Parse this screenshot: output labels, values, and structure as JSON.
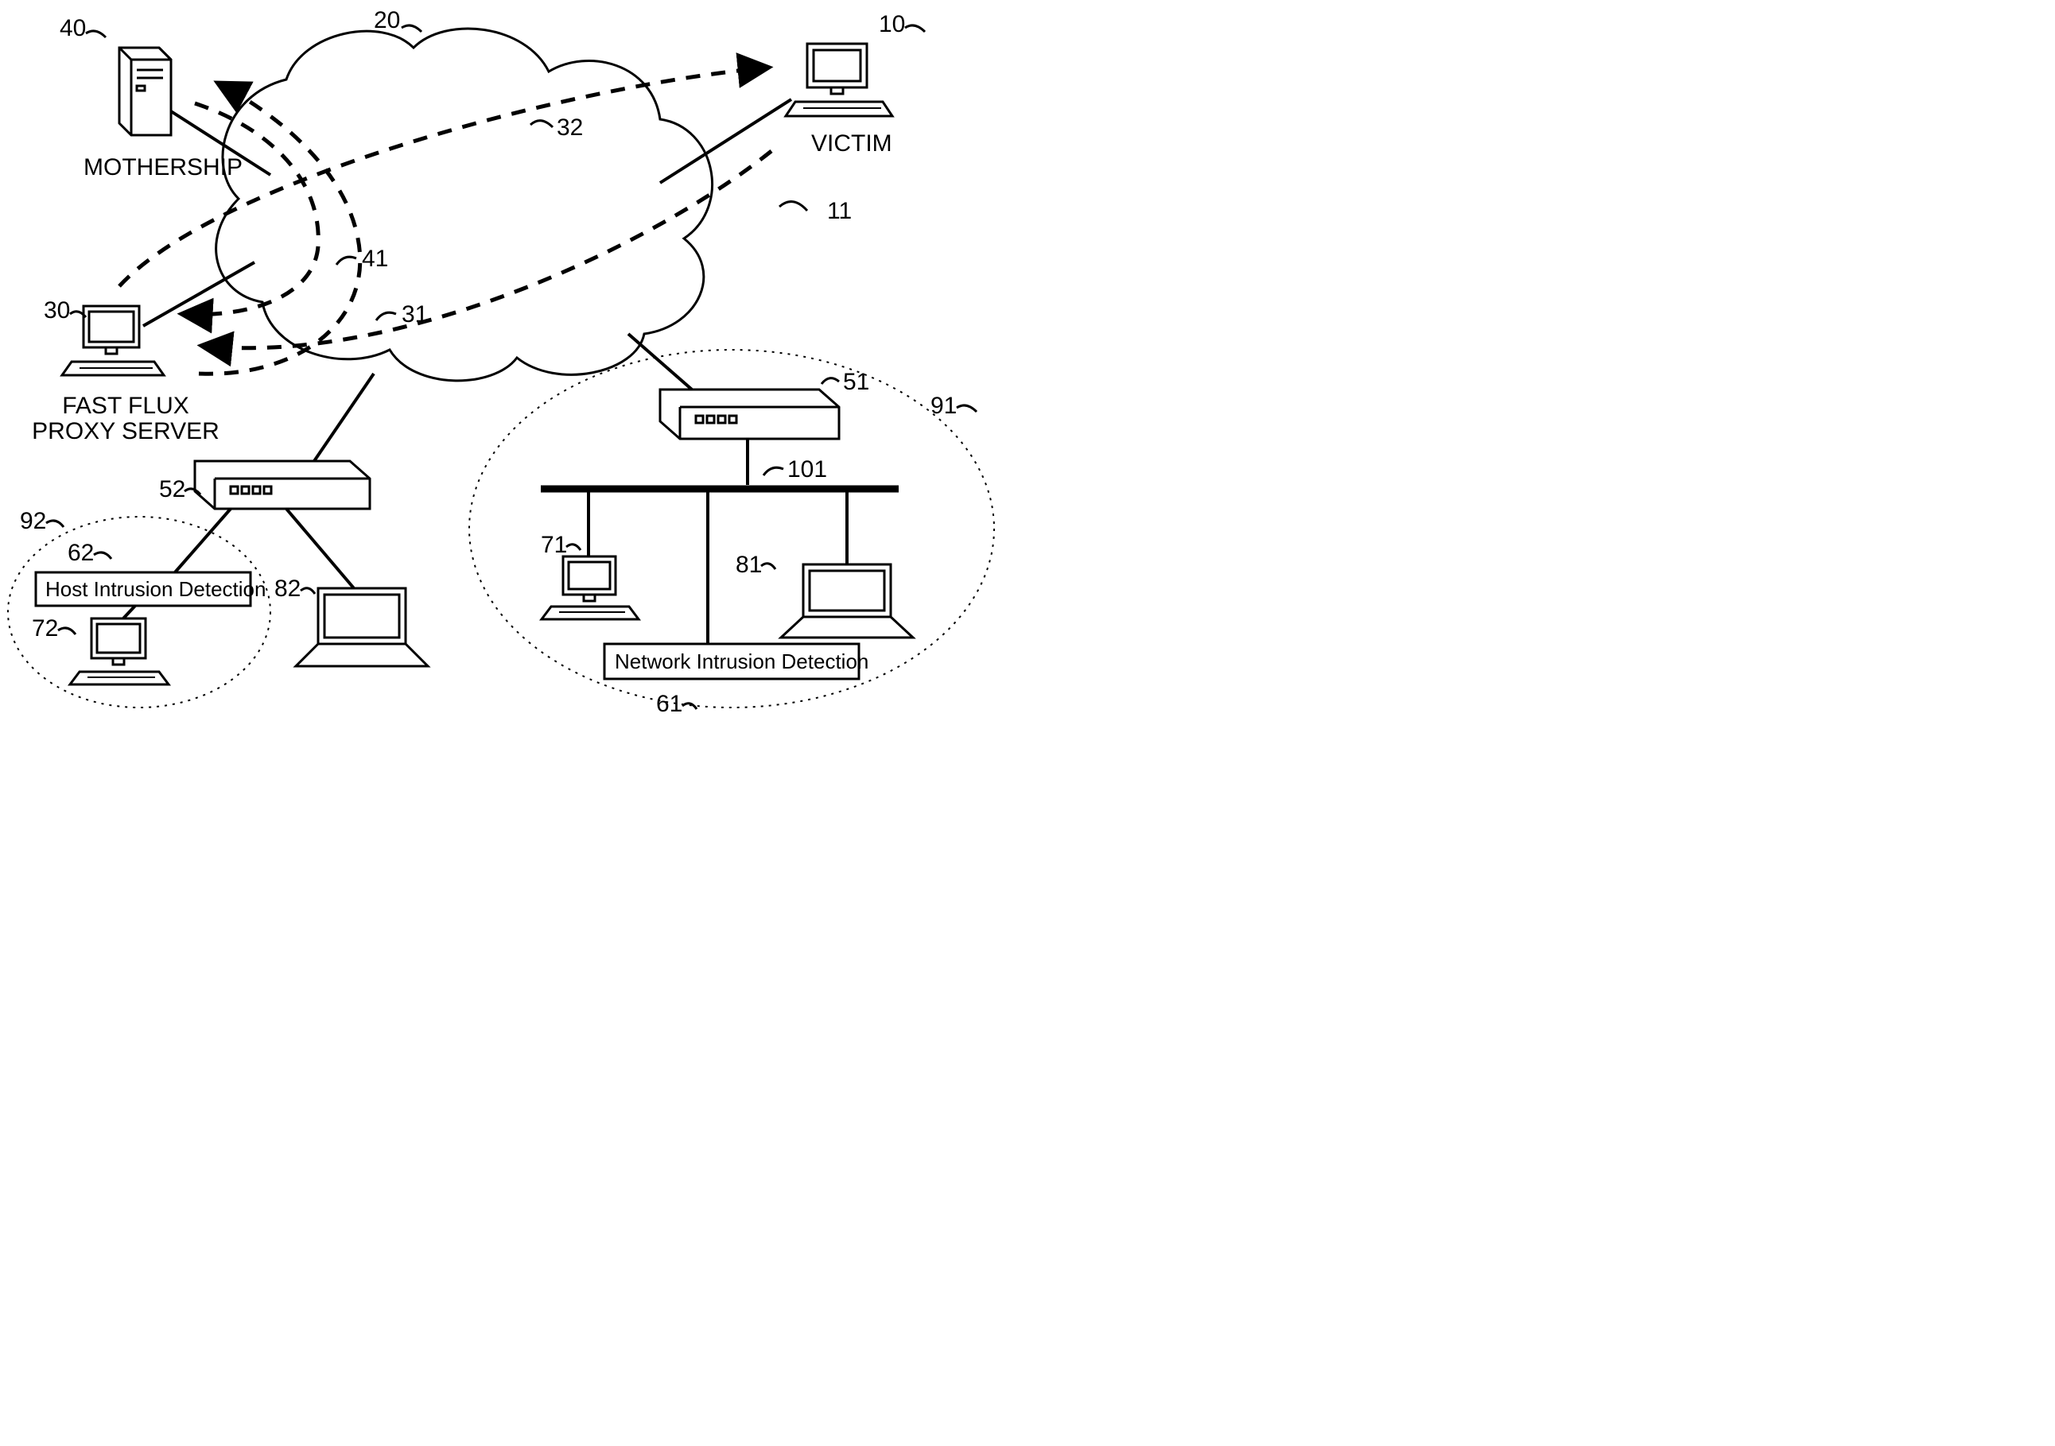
{
  "labels": {
    "mothership": "MOTHERSHIP",
    "victim": "VICTIM",
    "fastflux1": "FAST FLUX",
    "fastflux2": "PROXY SERVER",
    "hostIDS": "Host Intrusion Detection",
    "netIDS": "Network Intrusion Detection"
  },
  "refs": {
    "r40": "40",
    "r20": "20",
    "r10": "10",
    "r32": "32",
    "r11": "11",
    "r30": "30",
    "r41": "41",
    "r31": "31",
    "r51": "51",
    "r91": "91",
    "r52": "52",
    "r92": "92",
    "r62": "62",
    "r101": "101",
    "r82": "82",
    "r71": "71",
    "r81": "81",
    "r72": "72",
    "r61": "61"
  }
}
